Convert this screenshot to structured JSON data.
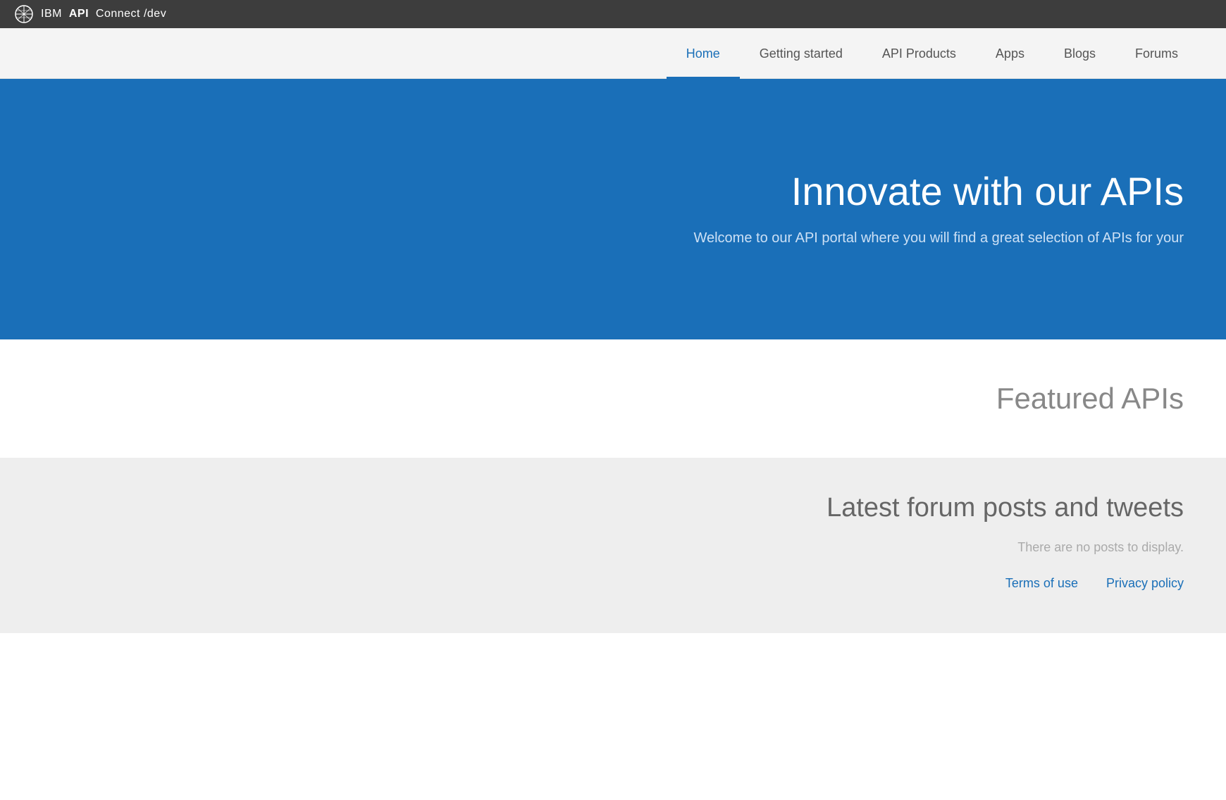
{
  "topbar": {
    "logo_alt": "IBM Logo",
    "title_ibm": "IBM",
    "title_api": "API",
    "title_connect": "Connect",
    "title_dev": "/dev"
  },
  "navbar": {
    "items": [
      {
        "label": "Home",
        "active": true,
        "id": "home"
      },
      {
        "label": "Getting started",
        "active": false,
        "id": "getting-started"
      },
      {
        "label": "API Products",
        "active": false,
        "id": "api-products"
      },
      {
        "label": "Apps",
        "active": false,
        "id": "apps"
      },
      {
        "label": "Blogs",
        "active": false,
        "id": "blogs"
      },
      {
        "label": "Forums",
        "active": false,
        "id": "forums"
      }
    ]
  },
  "hero": {
    "title": "Innovate with our APIs",
    "subtitle": "Welcome to our API portal where you will find a great selection of APIs for your"
  },
  "featured_apis": {
    "title": "Featured APIs"
  },
  "forum": {
    "title": "Latest forum posts and tweets",
    "empty_message": "There are no posts to display.",
    "links": [
      {
        "label": "Terms of use",
        "id": "terms-of-use"
      },
      {
        "label": "Privacy policy",
        "id": "privacy-policy"
      }
    ]
  }
}
